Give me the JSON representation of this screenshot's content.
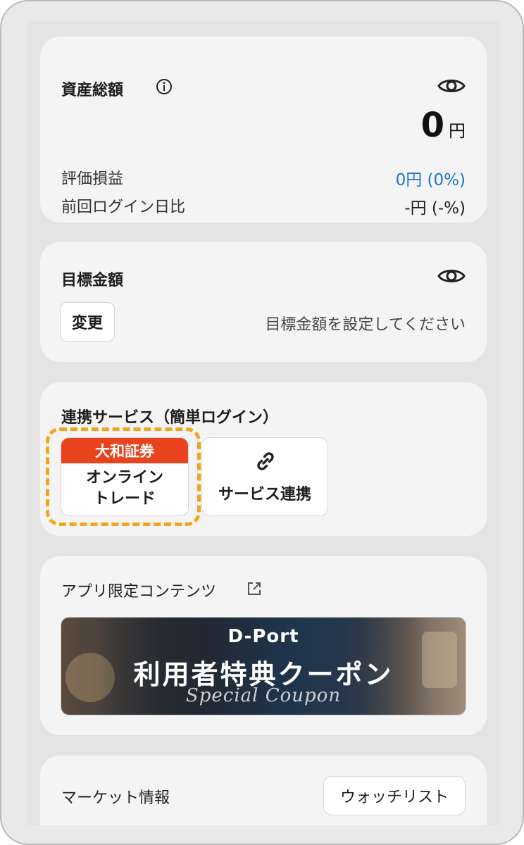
{
  "assets": {
    "title": "資産総額",
    "amount": "0",
    "unit": "円",
    "valuation_label": "評価損益",
    "valuation_value": "0円 (0%)",
    "since_login_label": "前回ログイン日比",
    "since_login_value": "-円 (-%)"
  },
  "goal": {
    "title": "目標金額",
    "change_label": "変更",
    "hint": "目標金額を設定してください"
  },
  "linked": {
    "title": "連携サービス（簡単ログイン）",
    "daiwa_header": "大和証券",
    "daiwa_line1": "オンライン",
    "daiwa_line2": "トレード",
    "service_label": "サービス連携"
  },
  "app_content": {
    "title": "アプリ限定コンテンツ",
    "banner_brand": "D-Port",
    "banner_title": "利用者特典クーポン",
    "banner_sub": "Special Coupon"
  },
  "market": {
    "title": "マーケット情報",
    "watchlist_label": "ウォッチリスト"
  },
  "icons": [
    "info-icon",
    "eye-icon",
    "link-icon",
    "external-link-icon"
  ],
  "colors": {
    "accent_blue": "#1a73d9",
    "brand_red": "#e8431c",
    "highlight_orange": "#f2a51b"
  }
}
